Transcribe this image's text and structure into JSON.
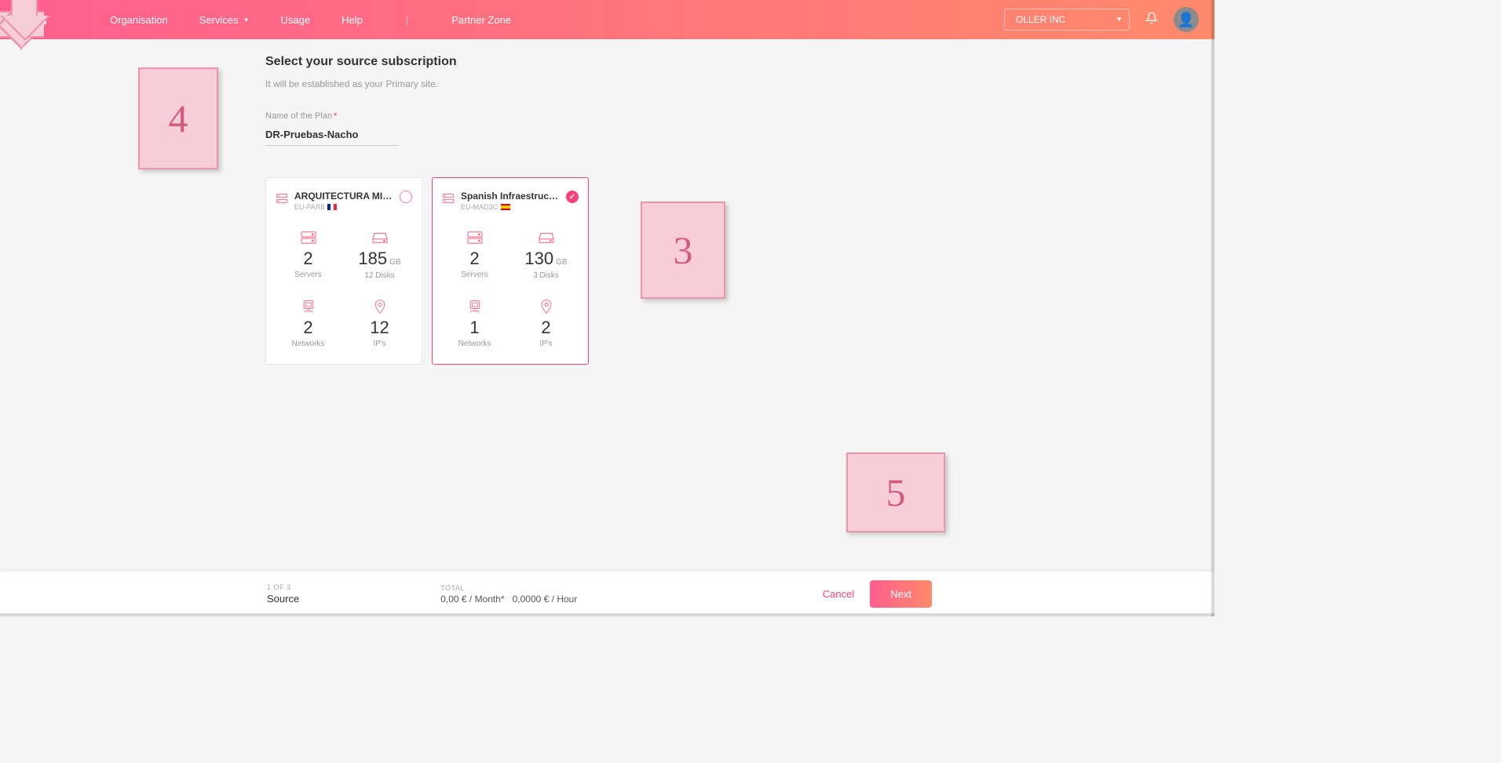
{
  "header": {
    "nav": {
      "organisation": "Organisation",
      "services": "Services",
      "usage": "Usage",
      "help": "Help",
      "partner_zone": "Partner Zone"
    },
    "org_selector": "OLLER INC"
  },
  "page": {
    "title": "Select your source subscription",
    "subtitle": "It will be established as your Primary site.",
    "plan_label": "Name of the Plan",
    "plan_value": "DR-Pruebas-Nacho"
  },
  "cards": [
    {
      "title": "ARQUITECTURA MICRO...",
      "region": "EU-PAR8",
      "flag": "fr",
      "selected": false,
      "stats": {
        "servers": {
          "value": "2",
          "label": "Servers"
        },
        "disks": {
          "value": "185",
          "unit": "GB",
          "label": "12 Disks"
        },
        "networks": {
          "value": "2",
          "label": "Networks"
        },
        "ips": {
          "value": "12",
          "label": "IP's"
        }
      }
    },
    {
      "title": "Spanish Infraestructure",
      "region": "EU-MAD3C",
      "flag": "es",
      "selected": true,
      "stats": {
        "servers": {
          "value": "2",
          "label": "Servers"
        },
        "disks": {
          "value": "130",
          "unit": "GB",
          "label": "3 Disks"
        },
        "networks": {
          "value": "1",
          "label": "Networks"
        },
        "ips": {
          "value": "2",
          "label": "IP's"
        }
      }
    }
  ],
  "footer": {
    "step_count": "1 OF 3",
    "step_name": "Source",
    "total_label": "TOTAL",
    "total_month": "0,00 € / Month*",
    "total_hour": "0,0000 € / Hour",
    "cancel": "Cancel",
    "next": "Next"
  },
  "callouts": {
    "c3": "3",
    "c4": "4",
    "c5": "5"
  }
}
